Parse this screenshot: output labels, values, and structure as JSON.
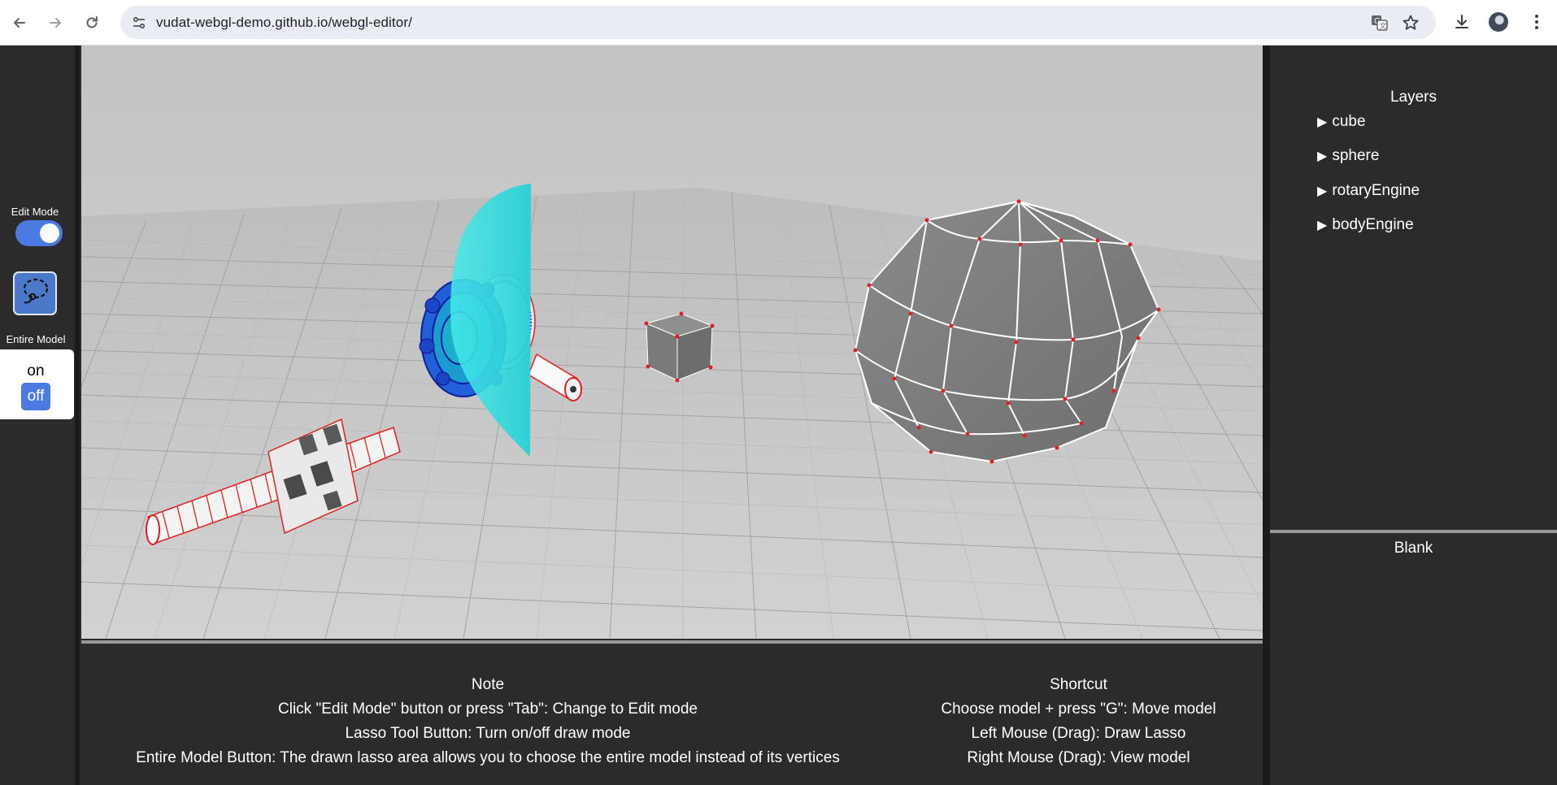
{
  "browser": {
    "url": "vudat-webgl-demo.github.io/webgl-editor/",
    "icons": [
      "back-icon",
      "forward-icon",
      "reload-icon",
      "site-info-icon",
      "translate-icon",
      "bookmark-star-icon",
      "download-icon",
      "profile-avatar",
      "menu-kebab-icon"
    ]
  },
  "toolbar": {
    "edit_mode_label": "Edit Mode",
    "edit_mode_on": true,
    "lasso_icon": "lasso-icon",
    "entire_model_label": "Entire Model",
    "on_label": "on",
    "off_label": "off",
    "entire_model_selected": "off"
  },
  "layers": {
    "title": "Layers",
    "items": [
      "cube",
      "sphere",
      "rotaryEngine",
      "bodyEngine"
    ]
  },
  "blank_panel": {
    "title": "Blank"
  },
  "notes": {
    "note_title": "Note",
    "note_lines": [
      "Click \"Edit Mode\" button or press \"Tab\": Change to Edit mode",
      "Lasso Tool Button: Turn on/off draw mode",
      "Entire Model Button: The drawn lasso area allows you to choose the entire model instead of its vertices"
    ],
    "shortcut_title": "Shortcut",
    "shortcut_lines": [
      "Choose model + press \"G\": Move model",
      "Left Mouse (Drag): Draw Lasso",
      "Right Mouse (Drag): View model"
    ]
  },
  "colors": {
    "accent_blue": "#4b7be0",
    "panel_bg": "#2b2b2b",
    "viewport_bg": "#c9c9c9",
    "selection_red": "#e02020",
    "lasso_cyan": "#33e6e6"
  }
}
